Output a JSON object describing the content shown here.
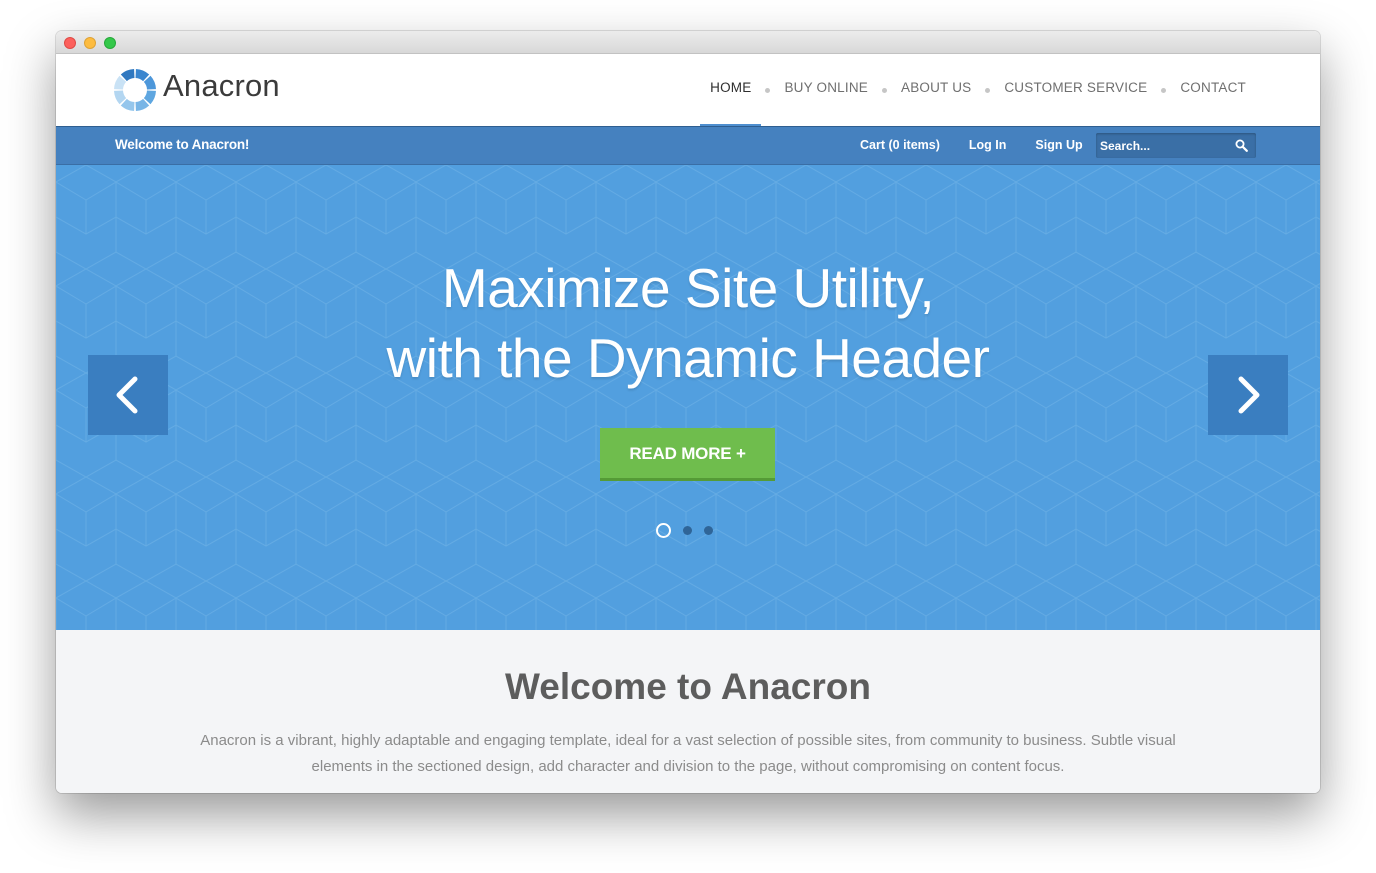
{
  "brand": {
    "name": "Anacron",
    "accent_color": "#529fdf",
    "logo_icon": "segmented-ring-icon"
  },
  "nav": {
    "items": [
      {
        "label": "HOME",
        "active": true
      },
      {
        "label": "BUY ONLINE",
        "active": false
      },
      {
        "label": "ABOUT US",
        "active": false
      },
      {
        "label": "CUSTOMER SERVICE",
        "active": false
      },
      {
        "label": "CONTACT",
        "active": false
      }
    ]
  },
  "topbar": {
    "welcome": "Welcome to Anacron!",
    "cart": "Cart (0 items)",
    "login": "Log In",
    "signup": "Sign Up",
    "search_placeholder": "Search...",
    "search_icon": "search-icon"
  },
  "hero": {
    "title_line1": "Maximize Site Utility,",
    "title_line2": "with the Dynamic Header",
    "button_label": "READ MORE +",
    "button_color": "#6fbd4d",
    "prev_icon": "chevron-left-icon",
    "next_icon": "chevron-right-icon",
    "slide_count": 3,
    "active_slide": 1
  },
  "intro": {
    "title": "Welcome to Anacron",
    "text": "Anacron is a vibrant, highly adaptable and engaging template, ideal for a vast selection of possible sites, from community to business. Subtle visual elements in the sectioned design, add character and division to the page, without compromising on content focus."
  }
}
